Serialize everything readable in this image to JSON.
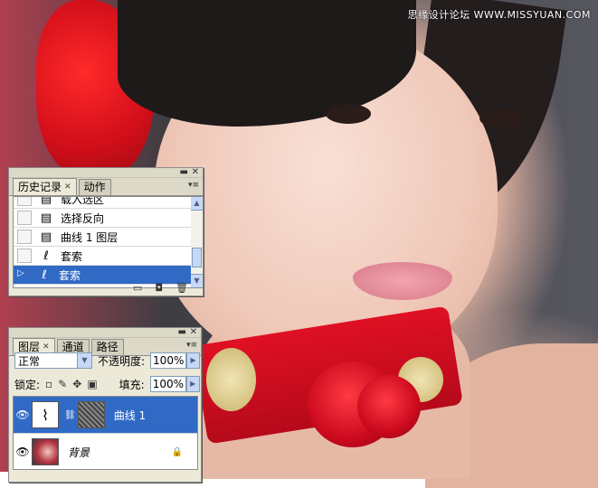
{
  "watermark": "思缘设计论坛 WWW.MISSYUAN.COM",
  "history_panel": {
    "tabs": [
      {
        "label": "历史记录",
        "active": true
      },
      {
        "label": "动作",
        "active": false
      }
    ],
    "items": [
      {
        "label": "载入选区",
        "icon": "action-icon",
        "selected": false
      },
      {
        "label": "选择反向",
        "icon": "action-icon",
        "selected": false
      },
      {
        "label": "曲线 1 图层",
        "icon": "action-icon",
        "selected": false
      },
      {
        "label": "套索",
        "icon": "lasso-icon",
        "selected": false
      },
      {
        "label": "套索",
        "icon": "lasso-icon",
        "selected": true
      }
    ]
  },
  "layers_panel": {
    "tabs": [
      {
        "label": "图层",
        "active": true
      },
      {
        "label": "通道",
        "active": false
      },
      {
        "label": "路径",
        "active": false
      }
    ],
    "blend_mode": "正常",
    "opacity_label": "不透明度:",
    "opacity_value": "100%",
    "lock_label": "锁定:",
    "fill_label": "填充:",
    "fill_value": "100%",
    "layers": [
      {
        "name": "曲线 1",
        "selected": true
      },
      {
        "name": "背景",
        "selected": false
      }
    ]
  },
  "colors": {
    "selection": "#316ac5",
    "panel_bg": "#ece9d8"
  }
}
